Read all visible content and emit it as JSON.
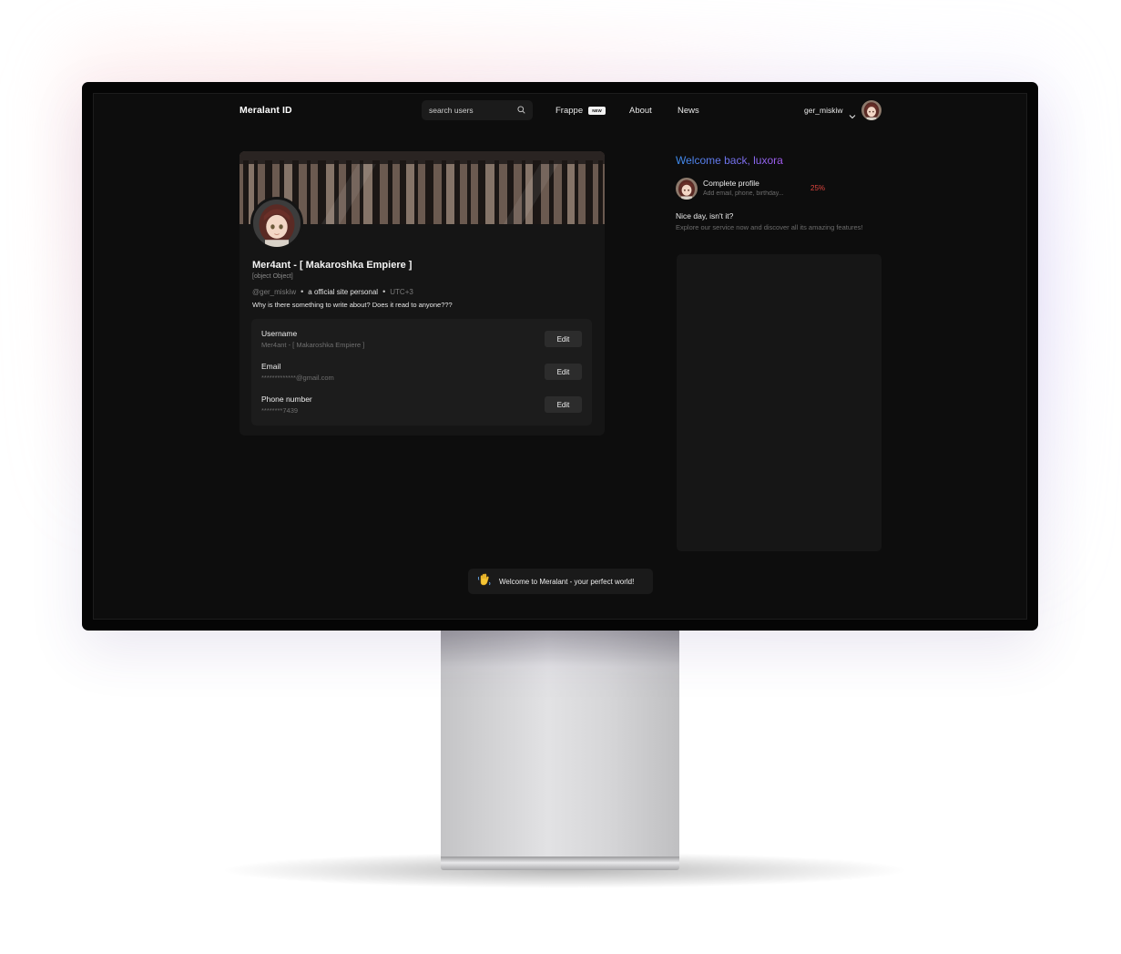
{
  "app": {
    "brand": "Meralant ID"
  },
  "nav": {
    "search_placeholder": "search users",
    "links": [
      {
        "label": "Frappe",
        "badge": "NEW"
      },
      {
        "label": "About"
      },
      {
        "label": "News"
      }
    ],
    "user": {
      "name": "ger_miskiw"
    }
  },
  "profile": {
    "display_name": "Mer4ant - [ Makaroshka Empiere ]",
    "object_label": "[object Object]",
    "handle": "@ger_miskiw",
    "role": "a official site personal",
    "timezone": "UTC+3",
    "bio": "Why is there something to write about? Does it read to anyone???",
    "fields": [
      {
        "label": "Username",
        "value": "Mer4ant - [ Makaroshka Empiere ]",
        "action": "Edit"
      },
      {
        "label": "Email",
        "value": "*************@gmail.com",
        "action": "Edit"
      },
      {
        "label": "Phone number",
        "value": "********7439",
        "action": "Edit"
      }
    ]
  },
  "sidebar": {
    "welcome": "Welcome back, luxora",
    "complete_profile": {
      "title": "Complete profile",
      "subtitle": "Add email, phone, birthday...",
      "percent": "25%"
    },
    "greeting": {
      "title": "Nice day, isn't it?",
      "subtitle": "Explore our service now and discover all its amazing features!"
    }
  },
  "toast": {
    "icon": "waving-hand-icon",
    "text": "Welcome to Meralant - your perfect world!"
  },
  "colors": {
    "accent_start": "#3d8ef0",
    "accent_end": "#a55bf0",
    "percent": "#e0453f"
  }
}
